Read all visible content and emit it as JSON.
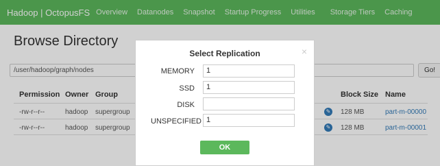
{
  "navbar": {
    "brand": "Hadoop | OctopusFS",
    "items": [
      "Overview",
      "Datanodes",
      "Snapshot",
      "Startup Progress",
      "Utilities",
      "Storage Tiers",
      "Caching"
    ]
  },
  "page_title": "Browse Directory",
  "path": {
    "value": "/user/hadoop/graph/nodes",
    "go_label": "Go!"
  },
  "table": {
    "headers": {
      "permission": "Permission",
      "owner": "Owner",
      "group": "Group",
      "block_size": "Block Size",
      "name": "Name"
    },
    "rows": [
      {
        "permission": "-rw-r--r--",
        "owner": "hadoop",
        "group": "supergroup",
        "block_size": "128 MB",
        "name": "part-m-00000"
      },
      {
        "permission": "-rw-r--r--",
        "owner": "hadoop",
        "group": "supergroup",
        "block_size": "128 MB",
        "name": "part-m-00001"
      }
    ]
  },
  "modal": {
    "title": "Select Replication",
    "close_glyph": "×",
    "fields": [
      {
        "label": "MEMORY",
        "value": "1"
      },
      {
        "label": "SSD",
        "value": "1"
      },
      {
        "label": "DISK",
        "value": ""
      },
      {
        "label": "UNSPECIFIED",
        "value": "1"
      }
    ],
    "ok_label": "OK"
  },
  "colors": {
    "navbar": "#5cb85c",
    "ok_button": "#5cb85c",
    "link": "#337ab7"
  }
}
